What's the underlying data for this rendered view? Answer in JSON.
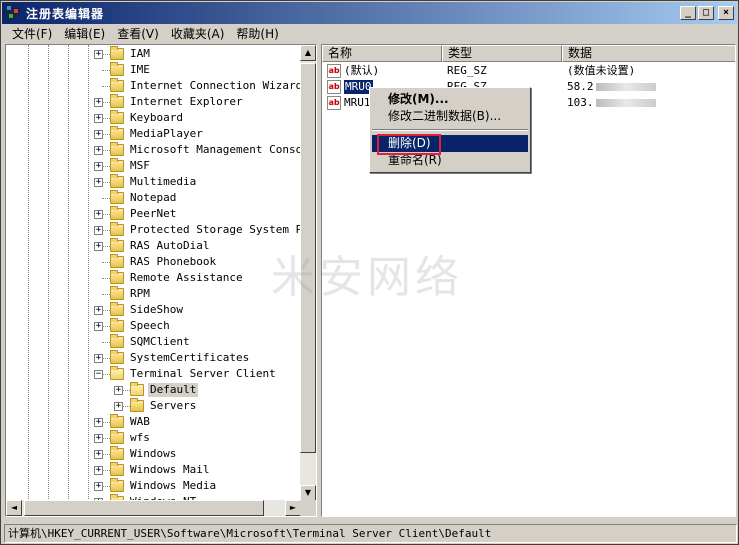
{
  "window": {
    "title": "注册表编辑器",
    "minimize": "_",
    "maximize": "□",
    "close": "×"
  },
  "menu": [
    "文件(F)",
    "编辑(E)",
    "查看(V)",
    "收藏夹(A)",
    "帮助(H)"
  ],
  "tree": {
    "items": [
      {
        "label": "IAM",
        "expander": "+",
        "level": 0
      },
      {
        "label": "IME",
        "expander": "",
        "level": 0
      },
      {
        "label": "Internet Connection Wizard",
        "expander": "",
        "level": 0
      },
      {
        "label": "Internet Explorer",
        "expander": "+",
        "level": 0
      },
      {
        "label": "Keyboard",
        "expander": "+",
        "level": 0
      },
      {
        "label": "MediaPlayer",
        "expander": "+",
        "level": 0
      },
      {
        "label": "Microsoft Management Console",
        "expander": "+",
        "level": 0
      },
      {
        "label": "MSF",
        "expander": "+",
        "level": 0
      },
      {
        "label": "Multimedia",
        "expander": "+",
        "level": 0
      },
      {
        "label": "Notepad",
        "expander": "",
        "level": 0
      },
      {
        "label": "PeerNet",
        "expander": "+",
        "level": 0
      },
      {
        "label": "Protected Storage System Prov",
        "expander": "+",
        "level": 0
      },
      {
        "label": "RAS AutoDial",
        "expander": "+",
        "level": 0
      },
      {
        "label": "RAS Phonebook",
        "expander": "",
        "level": 0
      },
      {
        "label": "Remote Assistance",
        "expander": "",
        "level": 0
      },
      {
        "label": "RPM",
        "expander": "",
        "level": 0
      },
      {
        "label": "SideShow",
        "expander": "+",
        "level": 0
      },
      {
        "label": "Speech",
        "expander": "+",
        "level": 0
      },
      {
        "label": "SQMClient",
        "expander": "",
        "level": 0
      },
      {
        "label": "SystemCertificates",
        "expander": "+",
        "level": 0
      },
      {
        "label": "Terminal Server Client",
        "expander": "−",
        "level": 0,
        "open": true
      },
      {
        "label": "Default",
        "expander": "+",
        "level": 1,
        "selected": true,
        "open": true
      },
      {
        "label": "Servers",
        "expander": "+",
        "level": 1
      },
      {
        "label": "WAB",
        "expander": "+",
        "level": 0
      },
      {
        "label": "wfs",
        "expander": "+",
        "level": 0
      },
      {
        "label": "Windows",
        "expander": "+",
        "level": 0
      },
      {
        "label": "Windows Mail",
        "expander": "+",
        "level": 0
      },
      {
        "label": "Windows Media",
        "expander": "+",
        "level": 0
      },
      {
        "label": "Windows NT",
        "expander": "+",
        "level": 0
      }
    ]
  },
  "list": {
    "columns": [
      "名称",
      "类型",
      "数据"
    ],
    "rows": [
      {
        "name": "(默认)",
        "type": "REG_SZ",
        "data": "(数值未设置)",
        "selected": false,
        "data_obscured": false
      },
      {
        "name": "MRU0",
        "type": "REG_SZ",
        "data": "58.2",
        "selected": true,
        "data_obscured": true
      },
      {
        "name": "MRU1",
        "type": "",
        "data": "103.",
        "selected": false,
        "data_obscured": true
      }
    ]
  },
  "context_menu": {
    "modify": "修改(M)...",
    "modify_binary": "修改二进制数据(B)...",
    "delete": "删除(D)",
    "rename": "重命名(R)"
  },
  "status": {
    "path": "计算机\\HKEY_CURRENT_USER\\Software\\Microsoft\\Terminal Server Client\\Default"
  },
  "watermark": "米安网络",
  "scroll": {
    "up_arrow": "▲",
    "down_arrow": "▼",
    "left_arrow": "◄",
    "right_arrow": "►"
  }
}
